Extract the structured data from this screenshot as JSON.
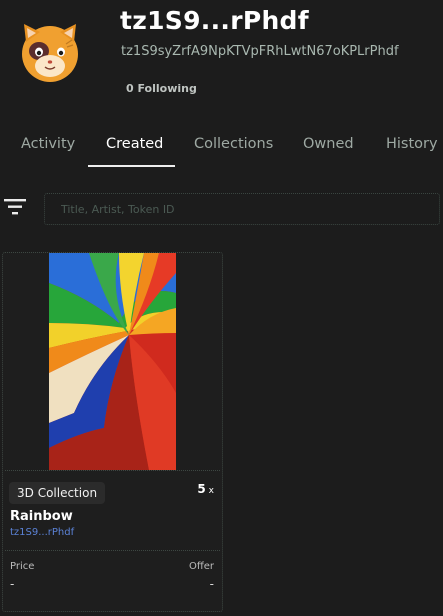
{
  "profile": {
    "avatar_icon": "cat-avatar-icon",
    "title": "tz1S9...rPhdf",
    "address": "tz1S9syZrfA9NpKTVpFRhLwtN67oKPLrPhdf",
    "following": "0 Following"
  },
  "tabs": [
    {
      "label": "Activity",
      "active": false
    },
    {
      "label": "Created",
      "active": true
    },
    {
      "label": "Collections",
      "active": false
    },
    {
      "label": "Owned",
      "active": false
    },
    {
      "label": "History",
      "active": false
    }
  ],
  "filter": {
    "icon": "filter-icon"
  },
  "search": {
    "placeholder": "Title, Artist, Token ID",
    "value": ""
  },
  "cards": [
    {
      "badge": "3D Collection",
      "editions": "5",
      "editions_suffix": "x",
      "name": "Rainbow",
      "creator": "tz1S9...rPhdf",
      "price_label": "Price",
      "offer_label": "Offer",
      "price": "-",
      "offer": "-"
    }
  ],
  "colors": {
    "background": "#1c1c1c",
    "text_primary": "#ffffff",
    "text_muted": "#9ea9a3",
    "link": "#5b82d6",
    "avatar_orange": "#f0a030"
  }
}
